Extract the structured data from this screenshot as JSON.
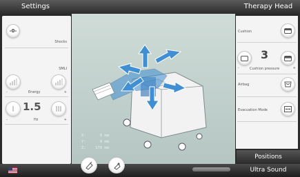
{
  "header": {
    "left_title": "Settings",
    "right_title": "Therapy Head"
  },
  "left_panel": {
    "shocks_label": "Shocks",
    "smli_label": "SMLI",
    "energy_label": "Energy",
    "energy_minus": "-",
    "energy_plus": "+",
    "hz_value": "1.5",
    "hz_label": "Hz",
    "hz_minus": "-",
    "hz_plus": "+"
  },
  "right_panel": {
    "cushion_label": "Cushion",
    "cushion_pressure_value": "3",
    "cushion_pressure_label": "Cushion pressure",
    "cushion_pressure_minus": "-",
    "cushion_pressure_plus": "+",
    "airbag_label": "Airbag",
    "evacuation_label": "Evacuation Mode"
  },
  "coords": {
    "x_label": "X:",
    "x_value": "0 mm",
    "y_label": "Y:",
    "y_value": "0 mm",
    "z_label": "Z:",
    "z_value": "170 mm"
  },
  "footer": {
    "positions_label": "Positions",
    "ultrasound_label": "Ultra Sound"
  },
  "colors": {
    "arrow_blue": "#3f8fd2",
    "device_white": "#f2f2f2"
  }
}
